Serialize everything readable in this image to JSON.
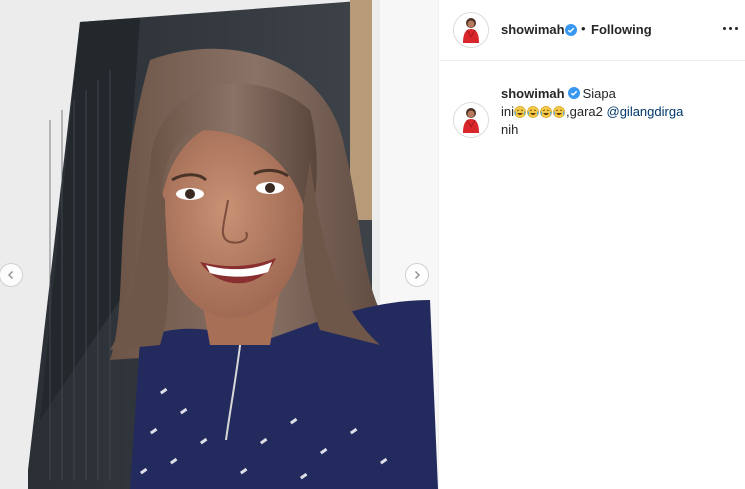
{
  "post": {
    "username": "showimah",
    "separator": "•",
    "follow_status": "Following",
    "more_icon": "more-horizontal-icon"
  },
  "caption": {
    "username": "showimah",
    "line_start": "Siapa",
    "word_before_emojis": "ini",
    "emoji_name": "face-with-tears-of-joy",
    "after_emojis": ",gara2 ",
    "mention": "@gilangdirga",
    "line_end": "nih"
  },
  "carousel": {
    "prev_icon": "chevron-left-icon",
    "next_icon": "chevron-right-icon"
  },
  "colors": {
    "verified_badge": "#3897f0",
    "mention_link": "#00376b",
    "avatar_red": "#d8262a",
    "jacket_navy": "#222a5e"
  }
}
